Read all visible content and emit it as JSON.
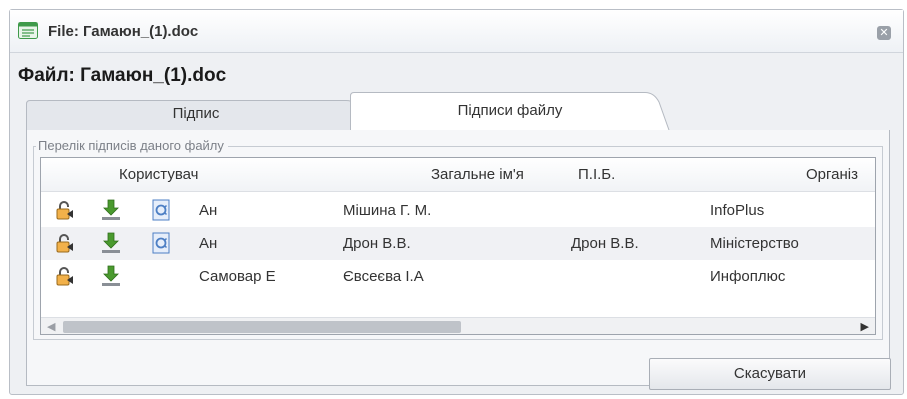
{
  "window": {
    "title": "File: Гамаюн_(1).doc",
    "close_glyph": "✕"
  },
  "heading": "Файл: Гамаюн_(1).doc",
  "tabs": [
    {
      "label": "Підпис",
      "active": false
    },
    {
      "label": "Підписи файлу",
      "active": true
    }
  ],
  "group": {
    "legend": "Перелік підписів даного файлу"
  },
  "table": {
    "columns": [
      "Користувач",
      "Загальне ім'я",
      "П.І.Б.",
      "Організ"
    ],
    "rows": [
      {
        "user": "Ан",
        "common_name": "Мішина Г. М.",
        "pib": "",
        "org": "InfoPlus",
        "icons": [
          "lock-icon",
          "download-icon",
          "certificate-icon"
        ]
      },
      {
        "user": "Ан",
        "common_name": "Дрон В.В.",
        "pib": "Дрон В.В.",
        "org": "Міністерство",
        "icons": [
          "lock-icon",
          "download-icon",
          "certificate-icon"
        ]
      },
      {
        "user": "Самовар Е",
        "common_name": "Євсеєва І.А",
        "pib": "",
        "org": "Инфоплюс",
        "icons": [
          "lock-icon",
          "download-icon"
        ]
      }
    ]
  },
  "buttons": {
    "cancel": "Скасувати"
  },
  "scroll": {
    "left_arrow": "◀",
    "right_arrow": "▶"
  },
  "colors": {
    "download_green": "#4a9a2e",
    "cert_blue": "#4d7fc4",
    "lock_orange": "#e8a23a"
  }
}
